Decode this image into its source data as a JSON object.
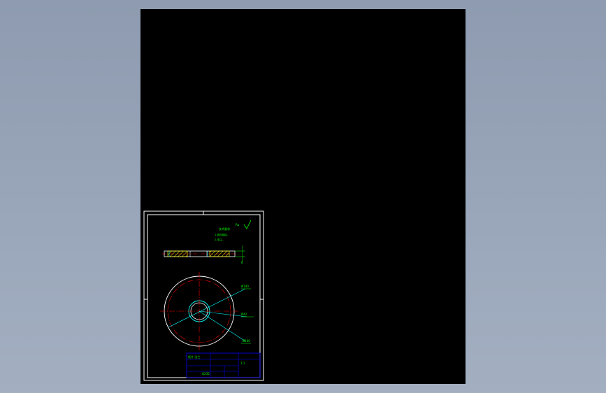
{
  "viewport": {
    "background": "#000000",
    "frame_color": "#ffffff",
    "annotation_color": "#00ff00",
    "centerline_color": "#ff0000",
    "section_line_color": "#ffff00",
    "hidden_edge_color": "#00ffff",
    "border_color": "#0000ff"
  },
  "drawing": {
    "notes": {
      "title": "技术要求",
      "lines": [
        "1.锐边倒钝。",
        "2.未注..."
      ]
    },
    "roughness_symbol": "Ra",
    "dimensions": [
      "6",
      "Ø140",
      "Ø42",
      "Ø100"
    ],
    "title_block": {
      "part_name": "纸片 法兰",
      "scale": "1:1",
      "material": "Q235"
    }
  }
}
